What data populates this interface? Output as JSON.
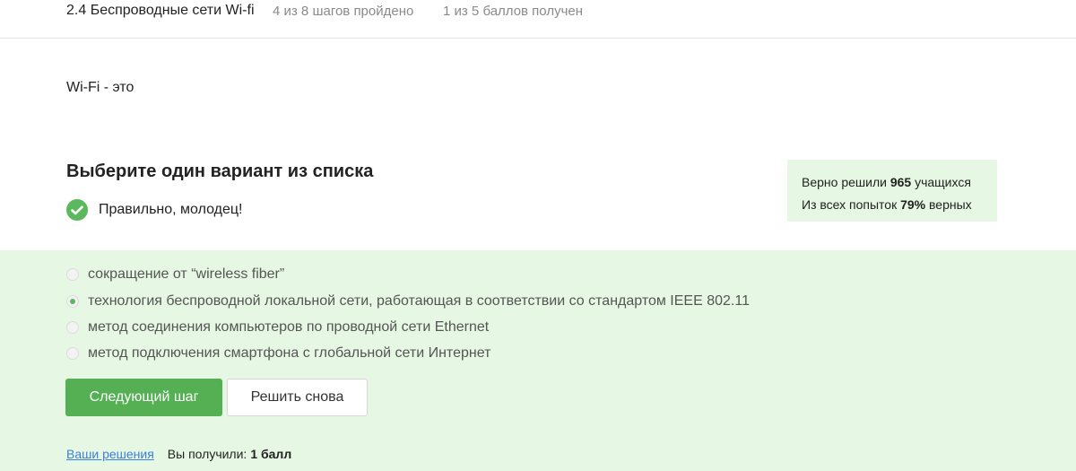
{
  "header": {
    "lesson_title": "2.4 Беспроводные сети Wi-fi",
    "steps_progress": "4 из 8 шагов пройдено",
    "points_progress": "1 из 5 баллов  получен"
  },
  "question": {
    "text": "Wi-Fi - это"
  },
  "prompt": "Выберите один вариант из списка",
  "result": {
    "message": "Правильно, молодец!",
    "icon": "check-icon",
    "color": "#5cb85c"
  },
  "stats": {
    "line1_prefix": "Верно решили ",
    "line1_value": "965",
    "line1_suffix": " учащихся",
    "line2_prefix": "Из всех попыток ",
    "line2_value": "79%",
    "line2_suffix": " верных"
  },
  "options": [
    {
      "label": "сокращение от “wireless fiber”",
      "selected": false
    },
    {
      "label": "технология беспроводной локальной сети, работающая в соответствии со стандартом IEEE 802.11",
      "selected": true
    },
    {
      "label": "метод соединения компьютеров по проводной сети Ethernet",
      "selected": false
    },
    {
      "label": "метод подключения смартфона с глобальной сети Интернет",
      "selected": false
    }
  ],
  "buttons": {
    "next": "Следующий шаг",
    "retry": "Решить снова"
  },
  "footer": {
    "solutions_link": "Ваши решения",
    "received_label": "Вы получили:",
    "received_value": "1 балл"
  },
  "colors": {
    "accent_green": "#54b053",
    "answer_background": "#e6f8e3",
    "link_blue": "#3b7fd8"
  }
}
